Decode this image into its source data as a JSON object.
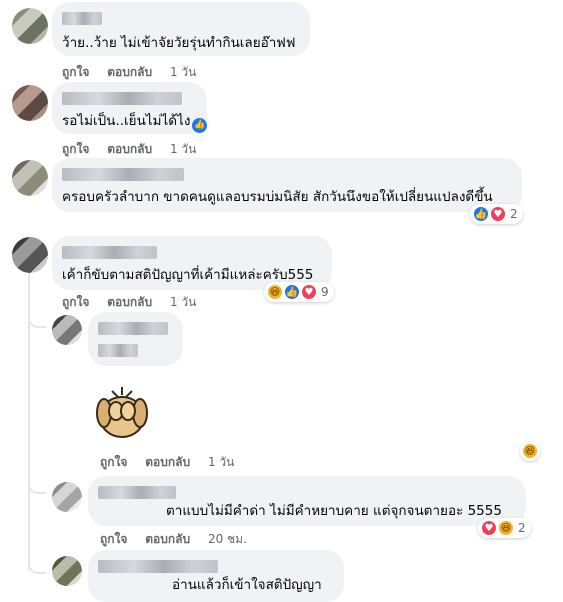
{
  "comments": [
    {
      "text": "ว้าย..ว้าย ไม่เข้าจัยวัยรุ่นทำกินเลยอ๊าฟฟ",
      "actions": {
        "like": "ถูกใจ",
        "reply": "ตอบกลับ",
        "time": "1 วัน"
      }
    },
    {
      "text": "รอไม่เป็น..เย็นไม่ได้ไง",
      "actions": {
        "like": "ถูกใจ",
        "reply": "ตอบกลับ",
        "time": "1 วัน"
      }
    },
    {
      "text": "ครอบครัวลำบาก ขาดคนดูแลอบรมบ่มนิสัย สักวันนึงขอให้เปลี่ยนแปลงดีขึ้น",
      "reactions": {
        "icons": [
          "like-icon",
          "love-icon"
        ],
        "count": "2"
      }
    },
    {
      "text": "เค้าก็ขับตามสติปัญญาที่เค้ามีแหล่ะครับ555",
      "actions": {
        "like": "ถูกใจ",
        "reply": "ตอบกลับ",
        "time": "1 วัน"
      },
      "reactions": {
        "icons": [
          "haha-icon",
          "like-icon",
          "love-icon"
        ],
        "count": "9"
      }
    }
  ],
  "replies": [
    {
      "sticker": "puppy-covering-face-sticker",
      "actions": {
        "like": "ถูกใจ",
        "reply": "ตอบกลับ",
        "time": "1 วัน"
      },
      "reactions": {
        "icons": [
          "haha-icon"
        ]
      }
    },
    {
      "text": "ตาแบบไม่มีคำด่า ไม่มีคำหยาบคาย แต่จุกจนตายอะ 5555",
      "actions": {
        "like": "ถูกใจ",
        "reply": "ตอบกลับ",
        "time": "20 ชม."
      },
      "reactions": {
        "icons": [
          "love-icon",
          "haha-icon"
        ],
        "count": "2"
      }
    },
    {
      "text": "อ่านแล้วก็เข้าใจสติปัญญา"
    }
  ],
  "colors": {
    "like": "#1877f2",
    "love": "#f33e58",
    "haha": "#f7b125",
    "bubble": "#f0f2f5",
    "meta": "#65676b"
  }
}
